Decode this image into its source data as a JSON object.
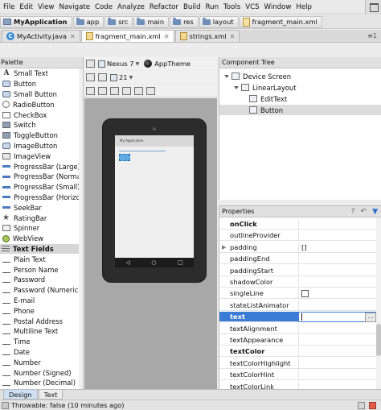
{
  "menu": [
    "File",
    "Edit",
    "View",
    "Navigate",
    "Code",
    "Analyze",
    "Refactor",
    "Build",
    "Run",
    "Tools",
    "VCS",
    "Window",
    "Help"
  ],
  "breadcrumb": [
    "MyApplication",
    "app",
    "src",
    "main",
    "res",
    "layout",
    "fragment_main.xml"
  ],
  "tabs": [
    {
      "label": "MyActivity.java",
      "active": false
    },
    {
      "label": "fragment_main.xml",
      "active": true
    },
    {
      "label": "strings.xml",
      "active": false
    }
  ],
  "tabs_more": "≡1",
  "palette": {
    "title": "Palette",
    "items": [
      {
        "label": "Small Text",
        "icon": "text"
      },
      {
        "label": "Button",
        "icon": "btn"
      },
      {
        "label": "Small Button",
        "icon": "btn"
      },
      {
        "label": "RadioButton",
        "icon": "radio"
      },
      {
        "label": "CheckBox",
        "icon": "check"
      },
      {
        "label": "Switch",
        "icon": "toggle"
      },
      {
        "label": "ToggleButton",
        "icon": "toggle"
      },
      {
        "label": "ImageButton",
        "icon": "btn"
      },
      {
        "label": "ImageView",
        "icon": "default"
      },
      {
        "label": "ProgressBar (Large)",
        "icon": "bar"
      },
      {
        "label": "ProgressBar (Normal)",
        "icon": "bar"
      },
      {
        "label": "ProgressBar (Small)",
        "icon": "bar"
      },
      {
        "label": "ProgressBar (Horizontal)",
        "icon": "bar"
      },
      {
        "label": "SeekBar",
        "icon": "seek"
      },
      {
        "label": "RatingBar",
        "icon": "star"
      },
      {
        "label": "Spinner",
        "icon": "spinner"
      },
      {
        "label": "WebView",
        "icon": "globe"
      },
      {
        "label": "Text Fields",
        "icon": "section"
      },
      {
        "label": "Plain Text",
        "icon": "tf"
      },
      {
        "label": "Person Name",
        "icon": "tf"
      },
      {
        "label": "Password",
        "icon": "tf"
      },
      {
        "label": "Password (Numeric)",
        "icon": "tf"
      },
      {
        "label": "E-mail",
        "icon": "tf"
      },
      {
        "label": "Phone",
        "icon": "tf"
      },
      {
        "label": "Postal Address",
        "icon": "tf"
      },
      {
        "label": "Multiline Text",
        "icon": "tf"
      },
      {
        "label": "Time",
        "icon": "tf"
      },
      {
        "label": "Date",
        "icon": "tf"
      },
      {
        "label": "Number",
        "icon": "tf"
      },
      {
        "label": "Number (Signed)",
        "icon": "tf"
      },
      {
        "label": "Number (Decimal)",
        "icon": "tf"
      }
    ]
  },
  "toolbar": {
    "device": "Nexus 7",
    "theme": "AppTheme",
    "api": "21"
  },
  "canvas": {
    "app_title": "My Application"
  },
  "component_tree": {
    "title": "Component Tree",
    "items": [
      {
        "label": "Device Screen",
        "level": 0
      },
      {
        "label": "LinearLayout",
        "level": 1
      },
      {
        "label": "EditText",
        "level": 2
      },
      {
        "label": "Button",
        "level": 2,
        "selected": true
      }
    ]
  },
  "properties": {
    "title": "Properties",
    "rows": [
      {
        "name": "onClick",
        "value": "",
        "bold": true
      },
      {
        "name": "outlineProvider",
        "value": ""
      },
      {
        "name": "padding",
        "value": "[]",
        "expandable": true
      },
      {
        "name": "paddingEnd",
        "value": ""
      },
      {
        "name": "paddingStart",
        "value": ""
      },
      {
        "name": "shadowColor",
        "value": ""
      },
      {
        "name": "singleLine",
        "value": "checkbox"
      },
      {
        "name": "stateListAnimator",
        "value": ""
      },
      {
        "name": "text",
        "value": "",
        "bold": true,
        "selected": true
      },
      {
        "name": "textAlignment",
        "value": ""
      },
      {
        "name": "textAppearance",
        "value": ""
      },
      {
        "name": "textColor",
        "value": "",
        "bold": true
      },
      {
        "name": "textColorHighlight",
        "value": ""
      },
      {
        "name": "textColorHint",
        "value": ""
      },
      {
        "name": "textColorLink",
        "value": ""
      }
    ]
  },
  "bottom_tabs": [
    {
      "label": "Design",
      "active": true
    },
    {
      "label": "Text",
      "active": false
    }
  ],
  "status": {
    "message": "Throwable: false (10 minutes ago)"
  },
  "colors": {
    "selection": "#3b7cd6",
    "canvas_bg": "#a8a8a8",
    "device_body": "#2c2c2c"
  }
}
